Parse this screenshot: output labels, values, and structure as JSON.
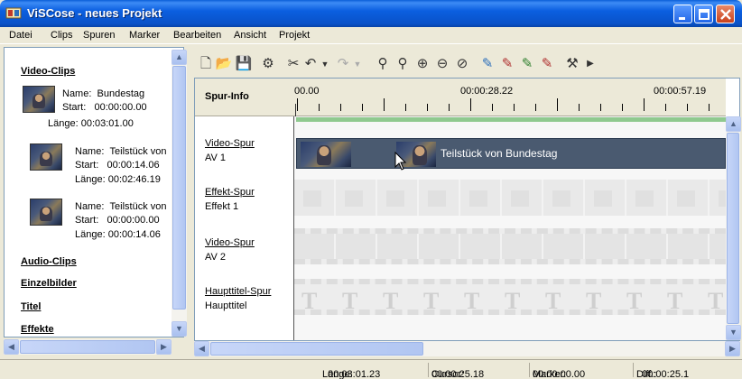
{
  "window": {
    "title": "ViSCose - neues Projekt",
    "accent": "#0a52c8"
  },
  "menu": [
    "Datei",
    "Clips",
    "Spuren",
    "Marker",
    "Bearbeiten",
    "Ansicht",
    "Projekt"
  ],
  "library": {
    "video_clips_label": "Video-Clips",
    "clips": [
      {
        "name_label": "Name:",
        "name": "Bundestag",
        "start_label": "Start:",
        "start": "00:00:00.00",
        "length_label": "Länge:",
        "length": "00:03:01.00"
      },
      {
        "name_label": "Name:",
        "name": "Teilstück von",
        "start_label": "Start:",
        "start": "00:00:14.06",
        "length_label": "Länge:",
        "length": "00:02:46.19"
      },
      {
        "name_label": "Name:",
        "name": "Teilstück von",
        "start_label": "Start:",
        "start": "00:00:00.00",
        "length_label": "Länge:",
        "length": "00:00:14.06"
      }
    ],
    "audio_clips_label": "Audio-Clips",
    "images_label": "Einzelbilder",
    "titles_label": "Titel",
    "effects_label": "Effekte"
  },
  "toolbar": {
    "icons": [
      "new-file-icon",
      "open-folder-icon",
      "save-icon",
      "render-icon",
      "cut-icon",
      "undo-icon",
      "undo-dropdown-icon",
      "redo-icon",
      "redo-dropdown-icon",
      "zoom-icon",
      "zoom-fit-icon",
      "zoom-in-icon",
      "zoom-out-icon",
      "zoom-reset-icon",
      "marker-add-icon",
      "marker-next-icon",
      "marker-prev-icon",
      "marker-delete-icon",
      "tools-icon",
      "more-icon"
    ]
  },
  "timeline": {
    "track_info_header": "Spur-Info",
    "ruler_labels": [
      "00.00",
      "00:00:28.22",
      "00:00:57.19"
    ],
    "tracks": [
      {
        "name": "Video-Spur",
        "sub": "AV 1"
      },
      {
        "name": "Effekt-Spur",
        "sub": "Effekt 1"
      },
      {
        "name": "Video-Spur",
        "sub": "AV 2"
      },
      {
        "name": "Haupttitel-Spur",
        "sub": "Haupttitel"
      }
    ],
    "clip_label": "Teilstück von Bundestag",
    "title_glyph": "T"
  },
  "status": {
    "length_label": "Länge:",
    "length": "00:03:01.23",
    "cursor_label": "Cursor:",
    "cursor": "00:00:25.18",
    "marker_label": "Marker:",
    "marker": "00:00:00.00",
    "diff_label": "Diff.:",
    "diff": "00:00:25.1"
  }
}
